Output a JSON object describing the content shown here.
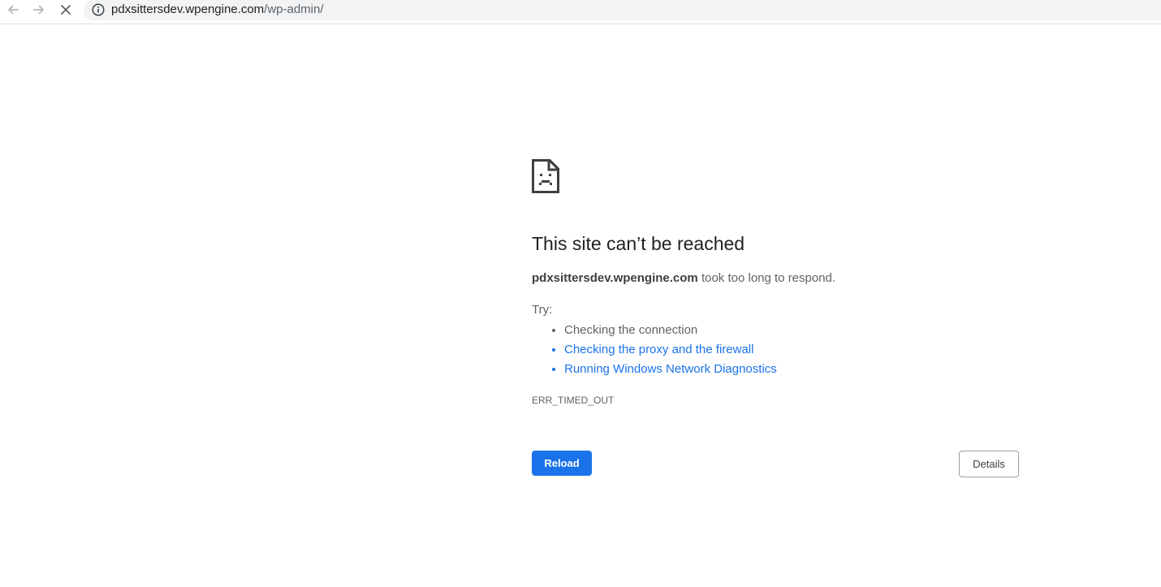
{
  "toolbar": {
    "back_icon": "arrow-left-icon",
    "forward_icon": "arrow-right-icon",
    "stop_icon": "close-icon",
    "site_info_icon": "info-icon",
    "url_host": "pdxsittersdev.wpengine.com",
    "url_path": "/wp-admin/"
  },
  "error_page": {
    "icon": "sad-page-icon",
    "heading": "This site can’t be reached",
    "summary_host": "pdxsittersdev.wpengine.com",
    "summary_text": " took too long to respond.",
    "try_label": "Try:",
    "suggestions": [
      {
        "text": "Checking the connection",
        "is_link": false
      },
      {
        "text": "Checking the proxy and the firewall",
        "is_link": true
      },
      {
        "text": "Running Windows Network Diagnostics",
        "is_link": true
      }
    ],
    "error_code": "ERR_TIMED_OUT",
    "reload_label": "Reload",
    "details_label": "Details"
  },
  "colors": {
    "link": "#1a73e8",
    "button_primary": "#1a73e8",
    "text_secondary": "#5f6368"
  }
}
